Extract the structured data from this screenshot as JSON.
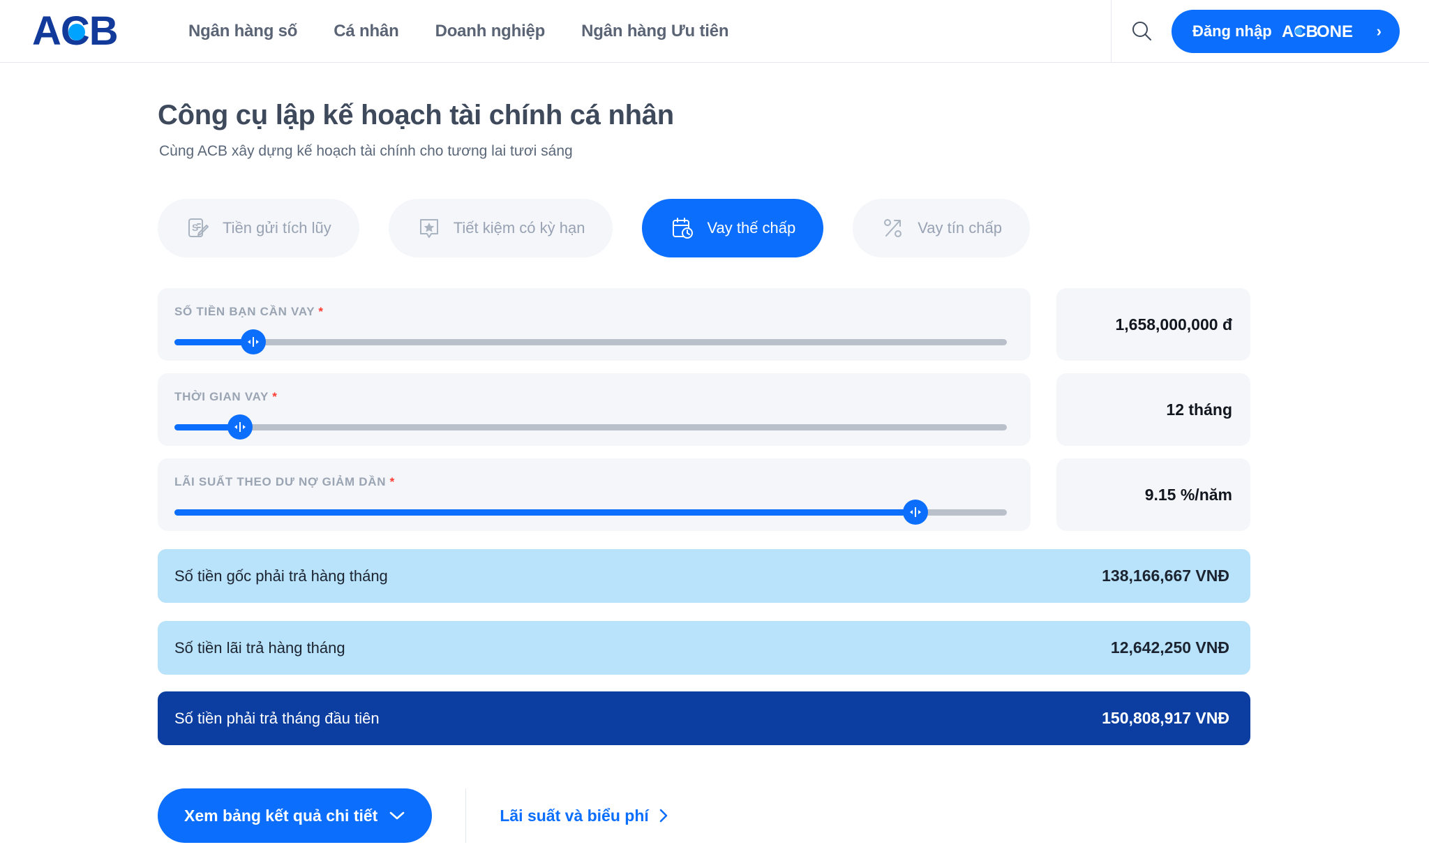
{
  "header": {
    "logo": {
      "text": "ACB",
      "dot_color": "#00a3ff",
      "color": "#123a9a"
    },
    "nav": [
      {
        "label": "Ngân hàng số"
      },
      {
        "label": "Cá nhân"
      },
      {
        "label": "Doanh nghiệp"
      },
      {
        "label": "Ngân hàng Ưu tiên"
      }
    ],
    "search_icon": "search-icon",
    "login": {
      "label": "Đăng nhập",
      "brand": "ACB",
      "brand_suffix": "ONE",
      "chevron": "›"
    }
  },
  "page": {
    "title": "Công cụ lập kế hoạch tài chính cá nhân",
    "subtitle": "Cùng ACB xây dựng kế hoạch tài chính cho tương lai tươi sáng"
  },
  "tabs": [
    {
      "label": "Tiền gửi tích lũy",
      "icon": "deposit-note-pencil-icon",
      "active": false
    },
    {
      "label": "Tiết kiệm có kỳ hạn",
      "icon": "star-badge-icon",
      "active": false
    },
    {
      "label": "Vay thế chấp",
      "icon": "calendar-clock-icon",
      "active": true
    },
    {
      "label": "Vay tín chấp",
      "icon": "percent-arrow-icon",
      "active": false
    }
  ],
  "sliders": [
    {
      "label": "Số tiền bạn cần vay",
      "required": "*",
      "percent": 9.5,
      "value": "1,658,000,000 đ"
    },
    {
      "label": "Thời gian vay",
      "required": "*",
      "percent": 7.9,
      "value": "12 tháng"
    },
    {
      "label": "Lãi suất theo dư nợ giảm dần",
      "required": "*",
      "percent": 89,
      "value": "9.15 %/năm"
    }
  ],
  "results": [
    {
      "label": "Số tiền gốc phải trả hàng tháng",
      "value": "138,166,667 VNĐ",
      "style": "light"
    },
    {
      "label": "Số tiền lãi trả hàng tháng",
      "value": "12,642,250 VNĐ",
      "style": "light"
    },
    {
      "label": "Số tiền phải trả tháng đầu tiên",
      "value": "150,808,917 VNĐ",
      "style": "dark"
    }
  ],
  "actions": {
    "primary_label": "Xem bảng kết quả chi tiết",
    "primary_chevron": "⌄",
    "link_label": "Lãi suất và biểu phí",
    "link_chevron": "›"
  },
  "colors": {
    "accent": "#0b6efd",
    "dark_blue": "#0b3ea0",
    "light_blue": "#b9e2fb",
    "field_bg": "#f4f6fa",
    "text": "#3e4a5b"
  }
}
